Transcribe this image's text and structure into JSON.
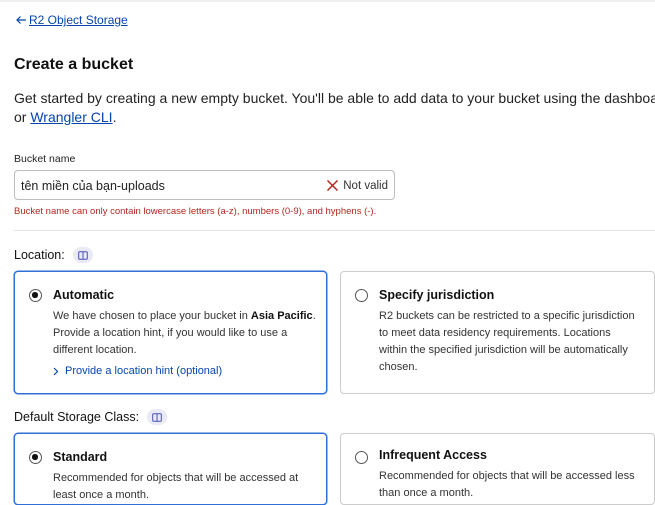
{
  "nav": {
    "back_label": "R2 Object Storage"
  },
  "page": {
    "title": "Create a bucket",
    "intro_text": "Get started by creating a new empty bucket. You'll be able to add data to your bucket using the dashboard or",
    "intro_link": "Wrangler CLI",
    "intro_end": "."
  },
  "bucket_name": {
    "label": "Bucket name",
    "value": "tên miền của bạn-uploads",
    "status": "Not valid",
    "error": "Bucket name can only contain lowercase letters (a-z), numbers (0-9), and hyphens (-)."
  },
  "location": {
    "label": "Location:",
    "options": [
      {
        "title": "Automatic",
        "selected": true,
        "desc_prefix": "We have chosen to place your bucket in ",
        "desc_bold": "Asia Pacific",
        "desc_suffix": ". Provide a location hint, if you would like to use a different location.",
        "link": "Provide a location hint (optional)"
      },
      {
        "title": "Specify jurisdiction",
        "selected": false,
        "desc": "R2 buckets can be restricted to a specific jurisdiction to meet data residency requirements. Locations within the specified jurisdiction will be automatically chosen."
      }
    ]
  },
  "storage_class": {
    "label": "Default Storage Class:",
    "options": [
      {
        "title": "Standard",
        "selected": true,
        "desc": "Recommended for objects that will be accessed at least once a month."
      },
      {
        "title": "Infrequent Access",
        "selected": false,
        "desc": "Recommended for objects that will be accessed less than once a month."
      }
    ]
  },
  "colors": {
    "link": "#0645ad",
    "error": "#b3261e",
    "selected_border": "#2f6fd6",
    "info_chip": "#e9eaf6"
  },
  "icons": [
    "arrow-left-icon",
    "x-mark-icon",
    "info-book-icon",
    "chevron-right-icon"
  ]
}
